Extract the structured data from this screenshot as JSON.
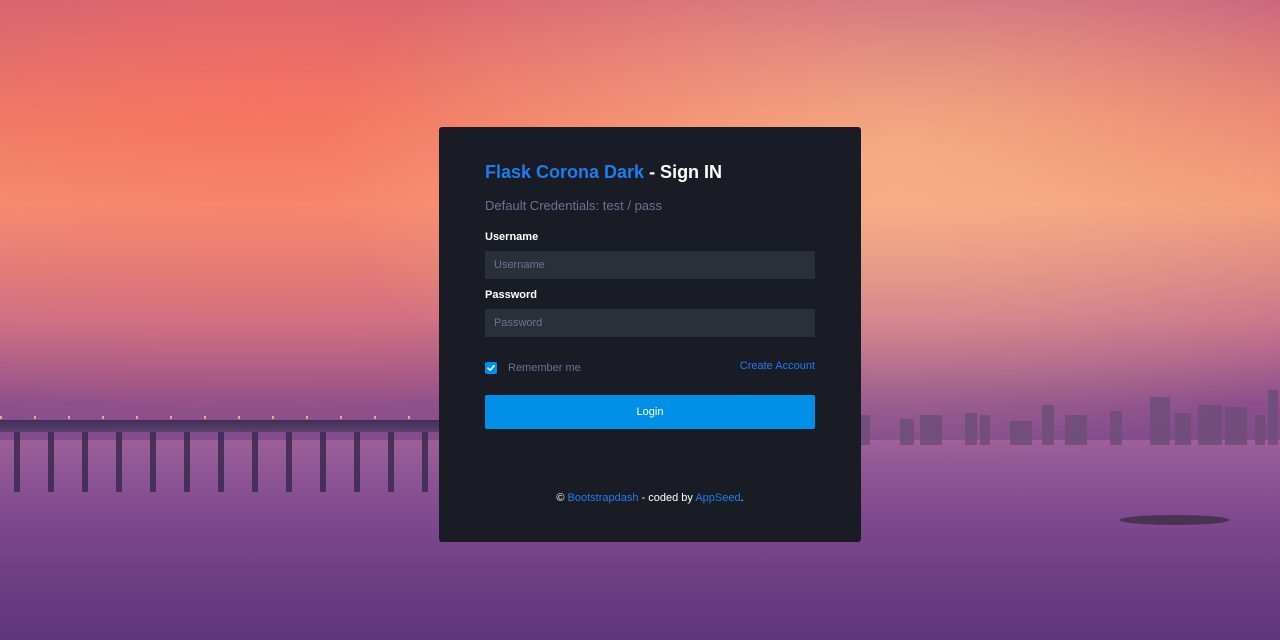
{
  "card": {
    "title_brand": "Flask Corona Dark",
    "title_rest": " - Sign IN",
    "subtitle": "Default Credentials: test / pass"
  },
  "form": {
    "username_label": "Username",
    "username_placeholder": "Username",
    "username_value": "",
    "password_label": "Password",
    "password_placeholder": "Password",
    "password_value": "",
    "remember_label": "Remember me",
    "remember_checked": true,
    "create_account_label": "Create Account",
    "login_label": "Login"
  },
  "footer": {
    "copyright": "©",
    "link1": "Bootstrapdash",
    "middle": " - coded by ",
    "link2": "AppSeed",
    "end": "."
  },
  "colors": {
    "card_bg": "#191c24",
    "input_bg": "#2a3038",
    "accent": "#0090e7",
    "link": "#1e7cf2",
    "muted": "#6c7293"
  },
  "icons": {
    "checkbox": "check-icon"
  }
}
